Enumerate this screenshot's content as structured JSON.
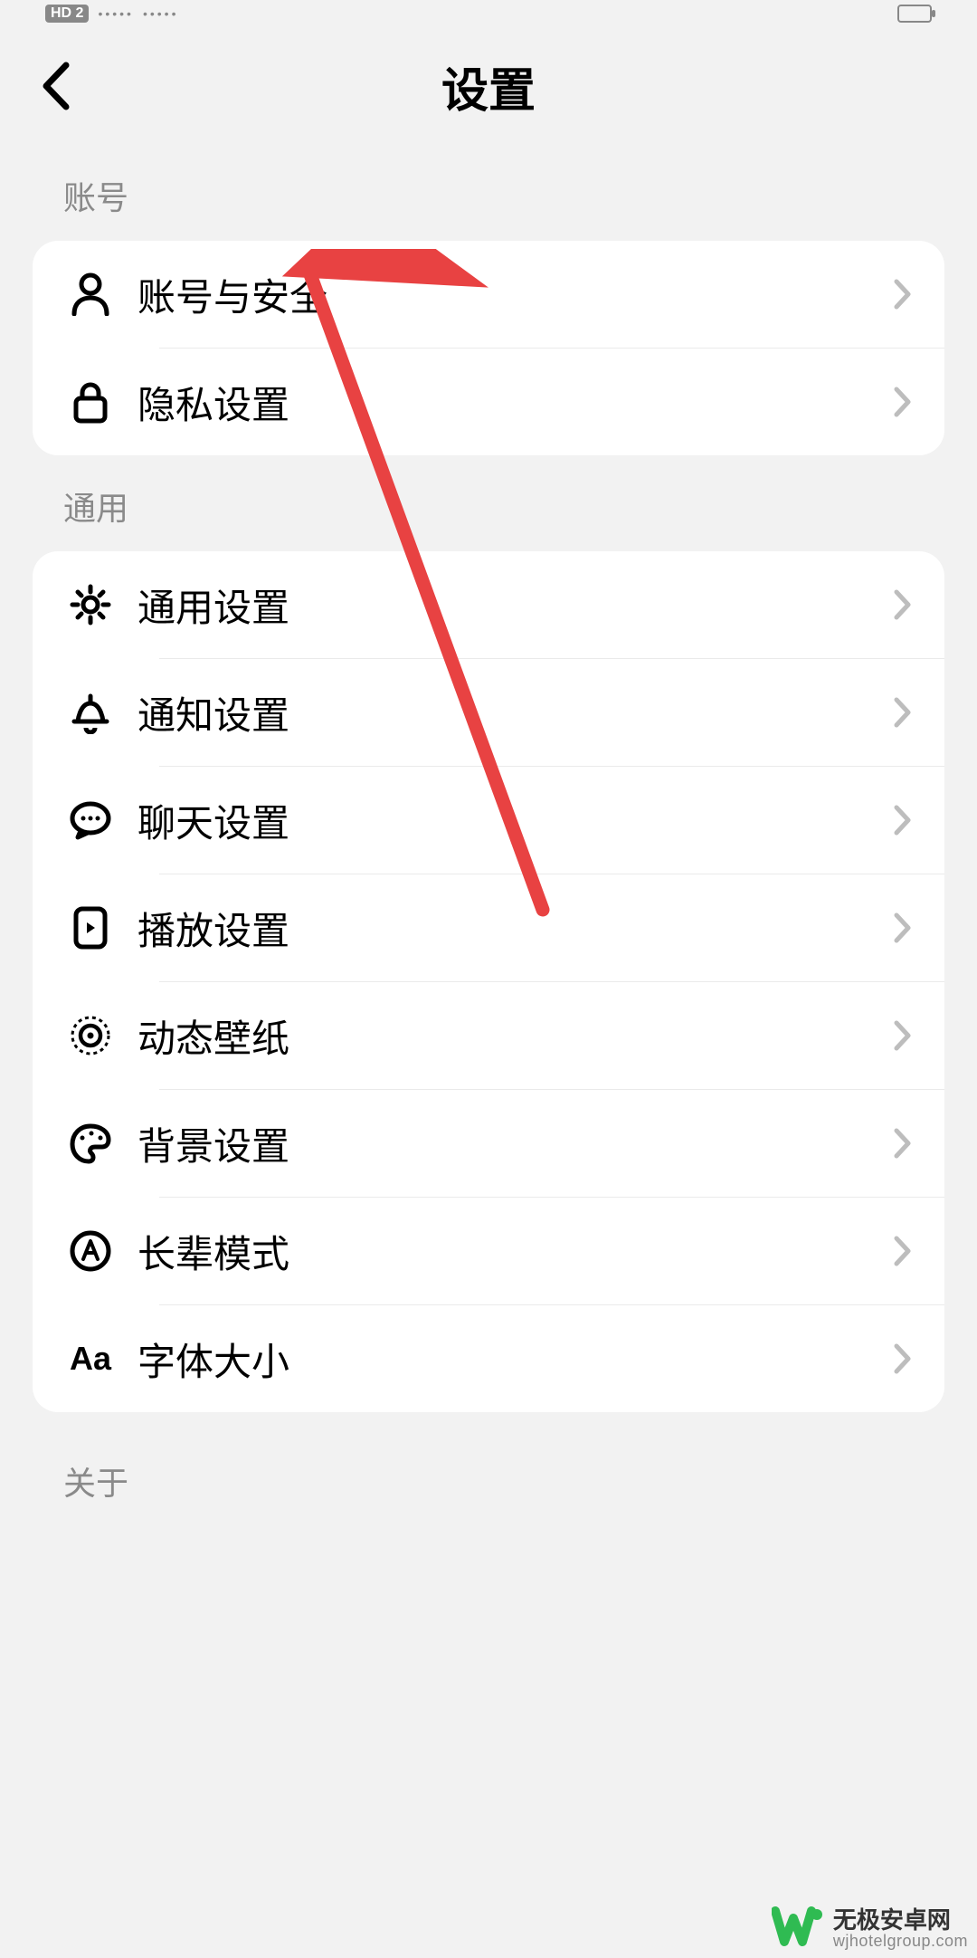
{
  "status_bar": {
    "hd": "HD 2"
  },
  "header": {
    "title": "设置"
  },
  "sections": {
    "account": {
      "heading": "账号",
      "items": [
        {
          "label": "账号与安全"
        },
        {
          "label": "隐私设置"
        }
      ]
    },
    "general": {
      "heading": "通用",
      "items": [
        {
          "label": "通用设置"
        },
        {
          "label": "通知设置"
        },
        {
          "label": "聊天设置"
        },
        {
          "label": "播放设置"
        },
        {
          "label": "动态壁纸"
        },
        {
          "label": "背景设置"
        },
        {
          "label": "长辈模式"
        },
        {
          "label": "字体大小"
        }
      ]
    },
    "about": {
      "heading": "关于"
    }
  },
  "watermark": {
    "line1": "无极安卓网",
    "line2": "wjhotelgroup.com"
  },
  "annotation": {
    "arrow_color": "#e84242"
  }
}
